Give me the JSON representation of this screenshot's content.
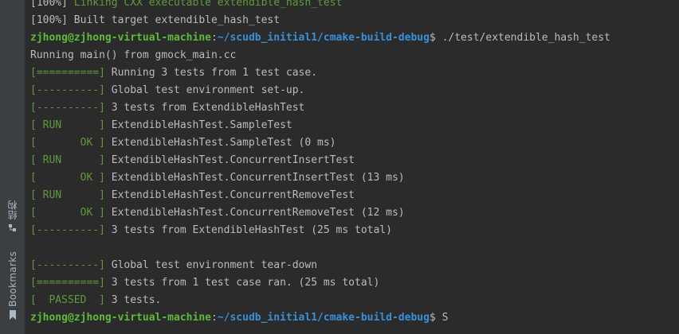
{
  "sidebar": {
    "structure_label": "结构",
    "bookmarks_label": "Bookmarks"
  },
  "colors": {
    "background": "#2b2b2b",
    "text": "#bbbbbb",
    "green": "#5f9a3a",
    "prompt_green": "#5fba3b",
    "path_blue": "#3a8fd8"
  },
  "terminal": {
    "lines": [
      [
        {
          "t": "[100%] ",
          "c": "gray"
        },
        {
          "t": "Linking CXX executable extendible_hash_test",
          "c": "green"
        }
      ],
      [
        {
          "t": "[100%] Built target extendible_hash_test",
          "c": "gray"
        }
      ],
      [
        {
          "t": "zjhong@zjhong-virtual-machine",
          "c": "bold-green"
        },
        {
          "t": ":",
          "c": "gray"
        },
        {
          "t": "~/scudb_initial1/cmake-build-debug",
          "c": "path"
        },
        {
          "t": "$ ./test/extendible_hash_test",
          "c": "gray"
        }
      ],
      [
        {
          "t": "Running main() from gmock_main.cc",
          "c": "gray"
        }
      ],
      [
        {
          "t": "[==========]",
          "c": "green"
        },
        {
          "t": " Running 3 tests from 1 test case.",
          "c": "gray"
        }
      ],
      [
        {
          "t": "[----------]",
          "c": "green"
        },
        {
          "t": " Global test environment set-up.",
          "c": "gray"
        }
      ],
      [
        {
          "t": "[----------]",
          "c": "green"
        },
        {
          "t": " 3 tests from ExtendibleHashTest",
          "c": "gray"
        }
      ],
      [
        {
          "t": "[ RUN      ]",
          "c": "green"
        },
        {
          "t": " ExtendibleHashTest.SampleTest",
          "c": "gray"
        }
      ],
      [
        {
          "t": "[       OK ]",
          "c": "green"
        },
        {
          "t": " ExtendibleHashTest.SampleTest (0 ms)",
          "c": "gray"
        }
      ],
      [
        {
          "t": "[ RUN      ]",
          "c": "green"
        },
        {
          "t": " ExtendibleHashTest.ConcurrentInsertTest",
          "c": "gray"
        }
      ],
      [
        {
          "t": "[       OK ]",
          "c": "green"
        },
        {
          "t": " ExtendibleHashTest.ConcurrentInsertTest (13 ms)",
          "c": "gray"
        }
      ],
      [
        {
          "t": "[ RUN      ]",
          "c": "green"
        },
        {
          "t": " ExtendibleHashTest.ConcurrentRemoveTest",
          "c": "gray"
        }
      ],
      [
        {
          "t": "[       OK ]",
          "c": "green"
        },
        {
          "t": " ExtendibleHashTest.ConcurrentRemoveTest (12 ms)",
          "c": "gray"
        }
      ],
      [
        {
          "t": "[----------]",
          "c": "green"
        },
        {
          "t": " 3 tests from ExtendibleHashTest (25 ms total)",
          "c": "gray"
        }
      ],
      [],
      [
        {
          "t": "[----------]",
          "c": "green"
        },
        {
          "t": " Global test environment tear-down",
          "c": "gray"
        }
      ],
      [
        {
          "t": "[==========]",
          "c": "green"
        },
        {
          "t": " 3 tests from 1 test case ran. (25 ms total)",
          "c": "gray"
        }
      ],
      [
        {
          "t": "[  PASSED  ]",
          "c": "green"
        },
        {
          "t": " 3 tests.",
          "c": "gray"
        }
      ],
      [
        {
          "t": "zjhong@zjhong-virtual-machine",
          "c": "bold-green"
        },
        {
          "t": ":",
          "c": "gray"
        },
        {
          "t": "~/scudb_initial1/cmake-build-debug",
          "c": "path"
        },
        {
          "t": "$ S",
          "c": "gray"
        }
      ]
    ]
  }
}
